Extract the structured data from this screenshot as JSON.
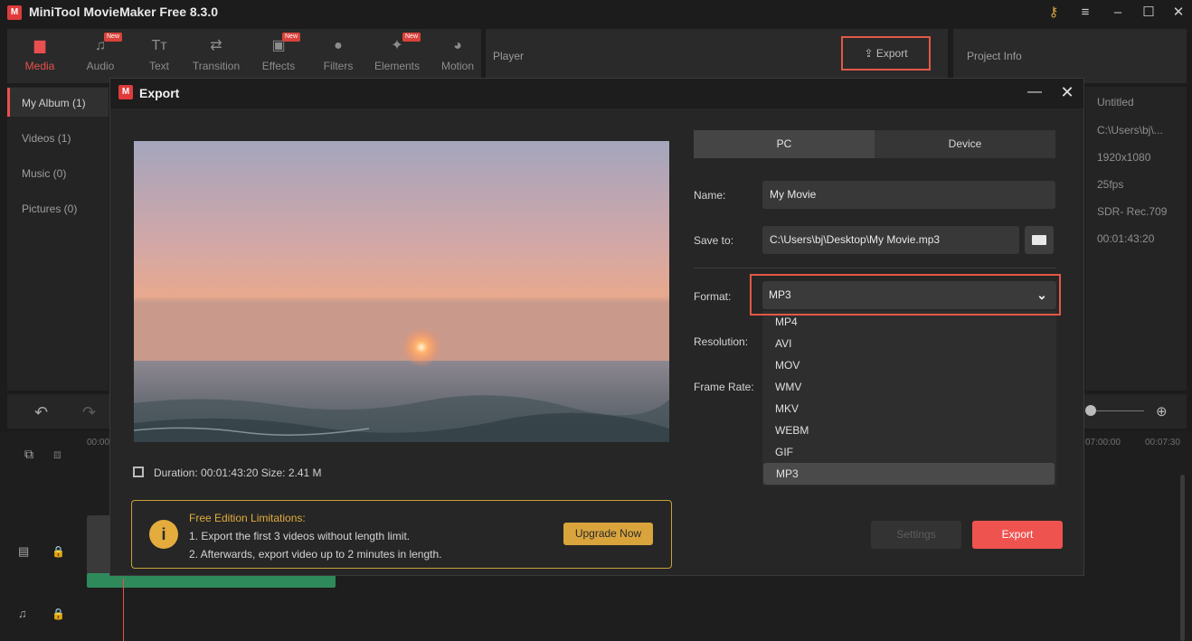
{
  "app": {
    "title": "MiniTool MovieMaker Free 8.3.0"
  },
  "toolbar": {
    "items": [
      {
        "label": "Media",
        "new": ""
      },
      {
        "label": "Audio",
        "new": "New"
      },
      {
        "label": "Text",
        "new": ""
      },
      {
        "label": "Transition",
        "new": ""
      },
      {
        "label": "Effects",
        "new": "New"
      },
      {
        "label": "Filters",
        "new": ""
      },
      {
        "label": "Elements",
        "new": "New"
      },
      {
        "label": "Motion",
        "new": ""
      }
    ]
  },
  "player": {
    "label": "Player",
    "export_label": "Export"
  },
  "project_info": {
    "label": "Project Info",
    "values": [
      "Untitled",
      "C:\\Users\\bj\\...",
      "1920x1080",
      "25fps",
      "SDR- Rec.709",
      "00:01:43:20"
    ]
  },
  "media_sidebar": {
    "items": [
      "My Album (1)",
      "Videos (1)",
      "Music (0)",
      "Pictures (0)"
    ]
  },
  "timeline": {
    "timecodes": [
      "00:00",
      "07:00:00",
      "00:07:30"
    ]
  },
  "export_dialog": {
    "title": "Export",
    "tabs": {
      "pc": "PC",
      "device": "Device"
    },
    "name_label": "Name:",
    "name_value": "My Movie",
    "save_label": "Save to:",
    "save_value": "C:\\Users\\bj\\Desktop\\My Movie.mp3",
    "format_label": "Format:",
    "format_value": "MP3",
    "resolution_label": "Resolution:",
    "framerate_label": "Frame Rate:",
    "format_options": [
      "MP4",
      "AVI",
      "MOV",
      "WMV",
      "MKV",
      "WEBM",
      "GIF",
      "MP3"
    ],
    "duration_label": "Duration:",
    "duration_value": "00:01:43:20",
    "size_label": "Size:",
    "size_value": "2.41 M",
    "notice": {
      "title": "Free Edition Limitations:",
      "line1": "1. Export the first 3 videos without length limit.",
      "line2": "2. Afterwards, export video up to 2 minutes in length."
    },
    "upgrade_label": "Upgrade Now",
    "settings_label": "Settings",
    "export_label": "Export"
  }
}
